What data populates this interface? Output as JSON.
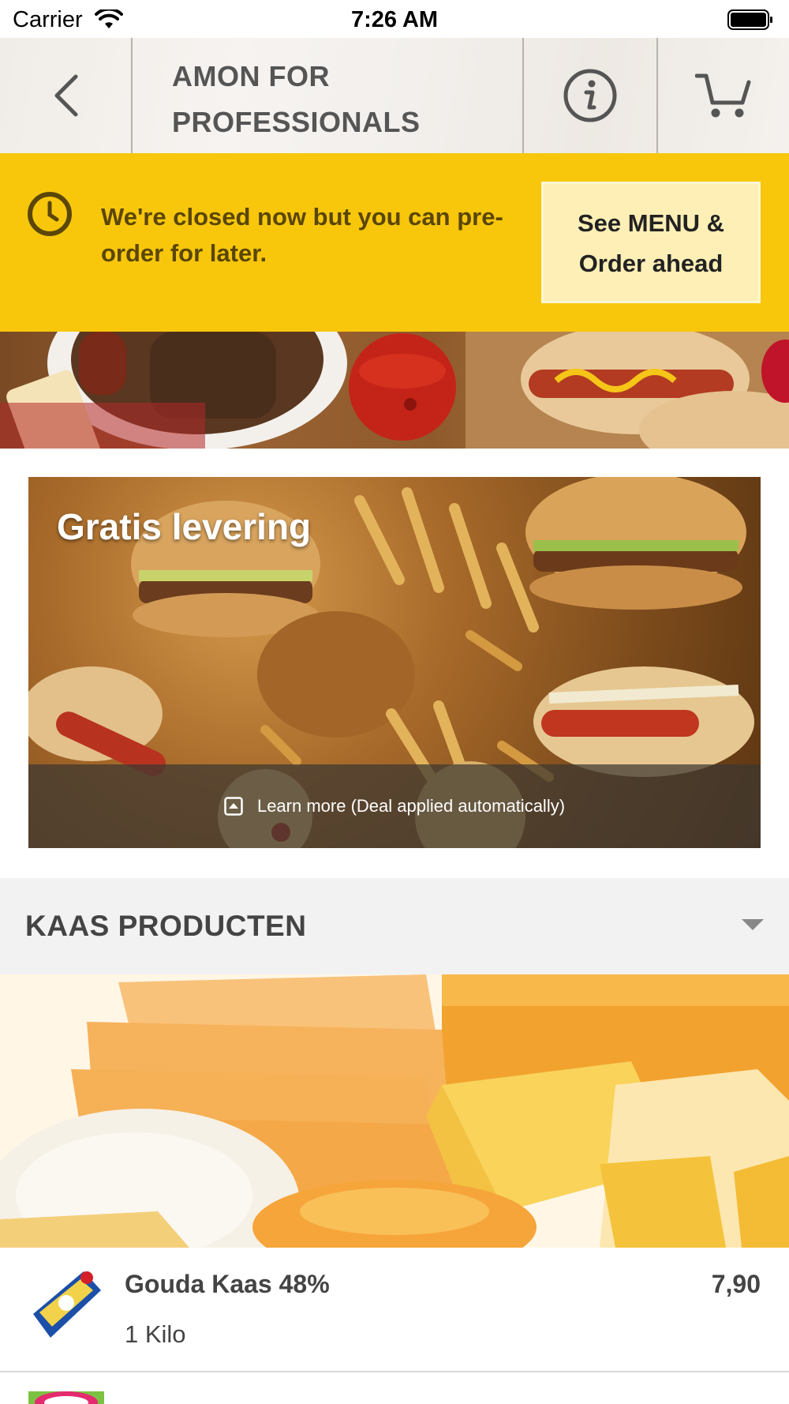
{
  "status_bar": {
    "carrier": "Carrier",
    "time": "7:26 AM"
  },
  "header": {
    "title_line1": "AMON FOR",
    "title_line2": "PROFESSIONALS"
  },
  "closed_banner": {
    "message": "We're closed now but you can pre-order for later.",
    "button_line1": "See MENU &",
    "button_line2": "Order ahead",
    "background": "#f8c70c"
  },
  "promo": {
    "title": "Gratis levering",
    "footer_text": "Learn more (Deal applied automatically)"
  },
  "category": {
    "title": "KAAS PRODUCTEN"
  },
  "products": [
    {
      "name": "Gouda Kaas 48%",
      "description": "1 Kilo",
      "price": "7,90"
    },
    {
      "name": "",
      "description": "",
      "price": ""
    }
  ],
  "icons": [
    "wifi-icon",
    "battery-icon",
    "back-icon",
    "info-icon",
    "cart-icon",
    "clock-icon",
    "expand-icon",
    "chevron-down-icon"
  ]
}
